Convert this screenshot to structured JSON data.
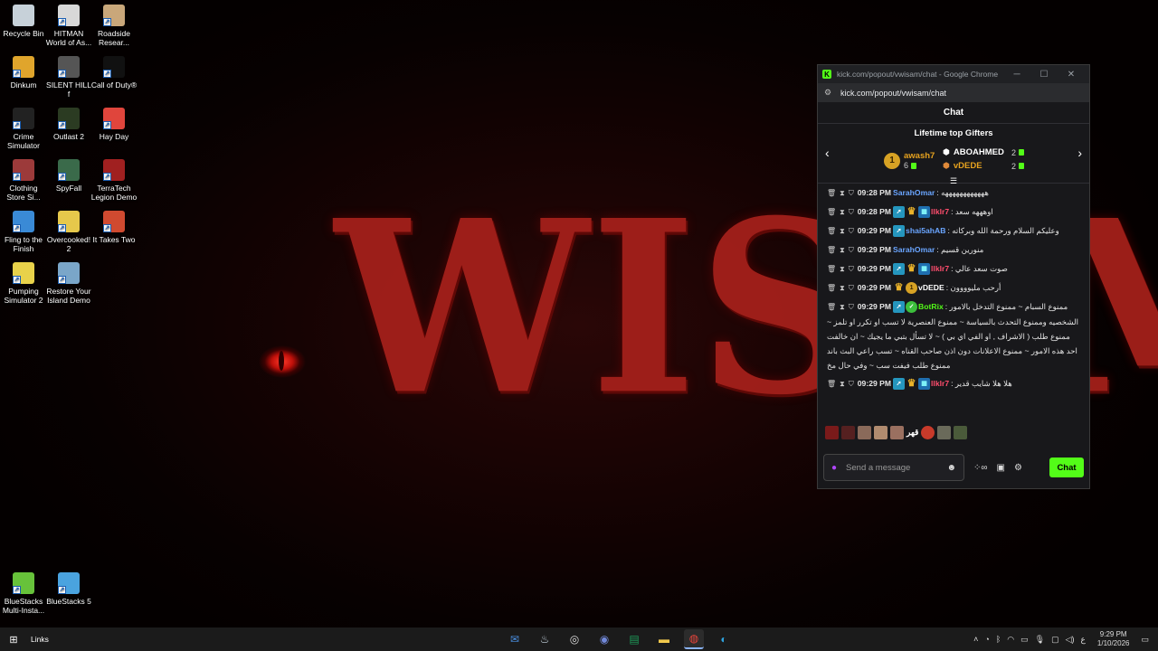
{
  "desktop": {
    "wallpaper_text": "WISAM",
    "icons": [
      {
        "label": "Recycle Bin",
        "icon": "recycle-bin-icon",
        "color": "#c7d1d9"
      },
      {
        "label": "HITMAN World of As...",
        "icon": "hitman-icon",
        "color": "#d8d8d8"
      },
      {
        "label": "Roadside Resear...",
        "icon": "roadside-research-icon",
        "color": "#c9a77a"
      },
      {
        "label": "Dinkum",
        "icon": "dinkum-icon",
        "color": "#e0a52c"
      },
      {
        "label": "SILENT HILL f",
        "icon": "silent-hill-icon",
        "color": "#555555"
      },
      {
        "label": "Call of Duty®",
        "icon": "call-of-duty-icon",
        "color": "#111111"
      },
      {
        "label": "Crime Simulator",
        "icon": "crime-simulator-icon",
        "color": "#222222"
      },
      {
        "label": "Outlast 2",
        "icon": "outlast-icon",
        "color": "#2b3b22"
      },
      {
        "label": "Hay Day",
        "icon": "hay-day-icon",
        "color": "#e0453c"
      },
      {
        "label": "Clothing Store Si...",
        "icon": "clothing-store-icon",
        "color": "#9c3a3a"
      },
      {
        "label": "SpyFall",
        "icon": "spyfall-icon",
        "color": "#3a6a4a"
      },
      {
        "label": "TerraTech Legion Demo",
        "icon": "terratech-icon",
        "color": "#a02020"
      },
      {
        "label": "Fling to the Finish",
        "icon": "fling-icon",
        "color": "#3a8ad6"
      },
      {
        "label": "Overcooked! 2",
        "icon": "overcooked-icon",
        "color": "#e6c84b"
      },
      {
        "label": "It Takes Two",
        "icon": "it-takes-two-icon",
        "color": "#d04a30"
      },
      {
        "label": "Pumping Simulator 2",
        "icon": "pumping-sim-icon",
        "color": "#e8d24a"
      },
      {
        "label": "Restore Your Island Demo",
        "icon": "restore-island-icon",
        "color": "#7aa6c9"
      },
      {
        "label": "BlueStacks Multi-Insta...",
        "icon": "bluestacks-multi-icon",
        "color": "#67c23a"
      },
      {
        "label": "BlueStacks 5",
        "icon": "bluestacks-icon",
        "color": "#4aa3df"
      }
    ]
  },
  "browser": {
    "title": "kick.com/popout/vwisam/chat - Google Chrome",
    "url": "kick.com/popout/vwisam/chat",
    "chat_header": "Chat",
    "gifters_title": "Lifetime top Gifters",
    "gifters": [
      {
        "rank": "1",
        "name": "awash7",
        "count": "6",
        "color": "#e6a21f"
      },
      {
        "name": "ABOAHMED",
        "count": "2",
        "color": "#ffffff"
      },
      {
        "name": "vDEDE",
        "count": "2",
        "color": "#e6a21f"
      }
    ],
    "messages": [
      {
        "time": "09:28 PM",
        "user": "SarahOmar",
        "user_color": "#6aa5ff",
        "text": "ههههههههههههه"
      },
      {
        "time": "09:28 PM",
        "user": "llklr7",
        "user_color": "#ff4d6d",
        "text": "اوهههه سعد"
      },
      {
        "time": "09:29 PM",
        "user": "shai5ahAB",
        "user_color": "#6aa5ff",
        "text": "وعليكم السلام ورحمة الله وبركاته"
      },
      {
        "time": "09:29 PM",
        "user": "SarahOmar",
        "user_color": "#6aa5ff",
        "text": "منورين قسيم"
      },
      {
        "time": "09:29 PM",
        "user": "llklr7",
        "user_color": "#ff4d6d",
        "text": "صوت سعد عالي"
      },
      {
        "time": "09:29 PM",
        "user": "vDEDE",
        "user_color": "#ffffff",
        "text": "أرحب مليوووون"
      },
      {
        "time": "09:29 PM",
        "user": "BotRix",
        "user_color": "#53fc18",
        "text": "ممنوع السبام ~ ممنوع التدخل بالامور الشخصيه وممنوع التحدث بالسياسة ~ ممنوع العنصرية لا تسب او تكرر او تلمز ~ ممنوع طلب ( الاشراف , او الفي اي بي ) ~ لا تسأل بتبي ما يجيك ~ ان خالفت احد هذه الامور ~ ممنوع الاعلانات دون اذن صاحب القناه ~ تسب راعي البث باند ممنوع طلب فيفت سب ~ وفي حال مخ"
      },
      {
        "time": "09:29 PM",
        "user": "llklr7",
        "user_color": "#ff4d6d",
        "text": "هلا هلا شايب قدير"
      }
    ],
    "emote_text": "قهر",
    "input_placeholder": "Send a message",
    "send_label": "Chat"
  },
  "taskbar": {
    "links_label": "Links",
    "time": "9:29 PM",
    "date": "1/10/2026",
    "lang": "ع"
  }
}
